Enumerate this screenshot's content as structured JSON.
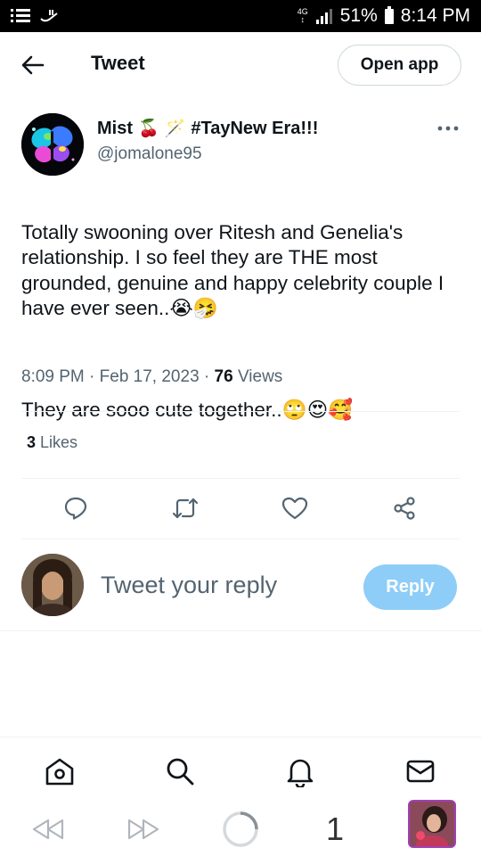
{
  "status_bar": {
    "network": "4G",
    "battery": "51%",
    "time": "8:14 PM"
  },
  "header": {
    "back_icon": "arrow-left-icon",
    "title": "Tweet",
    "open_app_label": "Open app"
  },
  "tweet": {
    "author_name": "Mist",
    "author_suffix": "#TayNew Era!!!",
    "handle": "@jomalone95",
    "body_line1": "Totally swooning over Ritesh and Genelia's relationship. I so feel they are THE most grounded, genuine and happy celebrity couple I have ever seen..",
    "body_line2": "They are sooo cute together..",
    "emoji_1": "😭",
    "emoji_2": "🤧",
    "emoji_3": "🙄",
    "emoji_4": "😍",
    "emoji_5": "🥰",
    "name_emoji_1": "🍒",
    "name_emoji_2": "🪄",
    "time": "8:09 PM",
    "separator": "·",
    "date": "Feb 17, 2023",
    "views_count": "76",
    "views_label": "Views",
    "likes_count": "3",
    "likes_label": "Likes"
  },
  "actions": {
    "reply_icon": "reply-icon",
    "retweet_icon": "retweet-icon",
    "like_icon": "heart-icon",
    "share_icon": "share-icon"
  },
  "reply_box": {
    "placeholder": "Tweet your reply",
    "button_label": "Reply"
  },
  "bottom_nav": {
    "items": [
      "home-icon",
      "search-icon",
      "notifications-icon",
      "messages-icon"
    ]
  },
  "browser_bar": {
    "tab_count": "1"
  },
  "colors": {
    "accent_disabled": "#8ecdf7",
    "text_primary": "#0f1419",
    "text_secondary": "#536471",
    "divider": "#eff3f4"
  }
}
